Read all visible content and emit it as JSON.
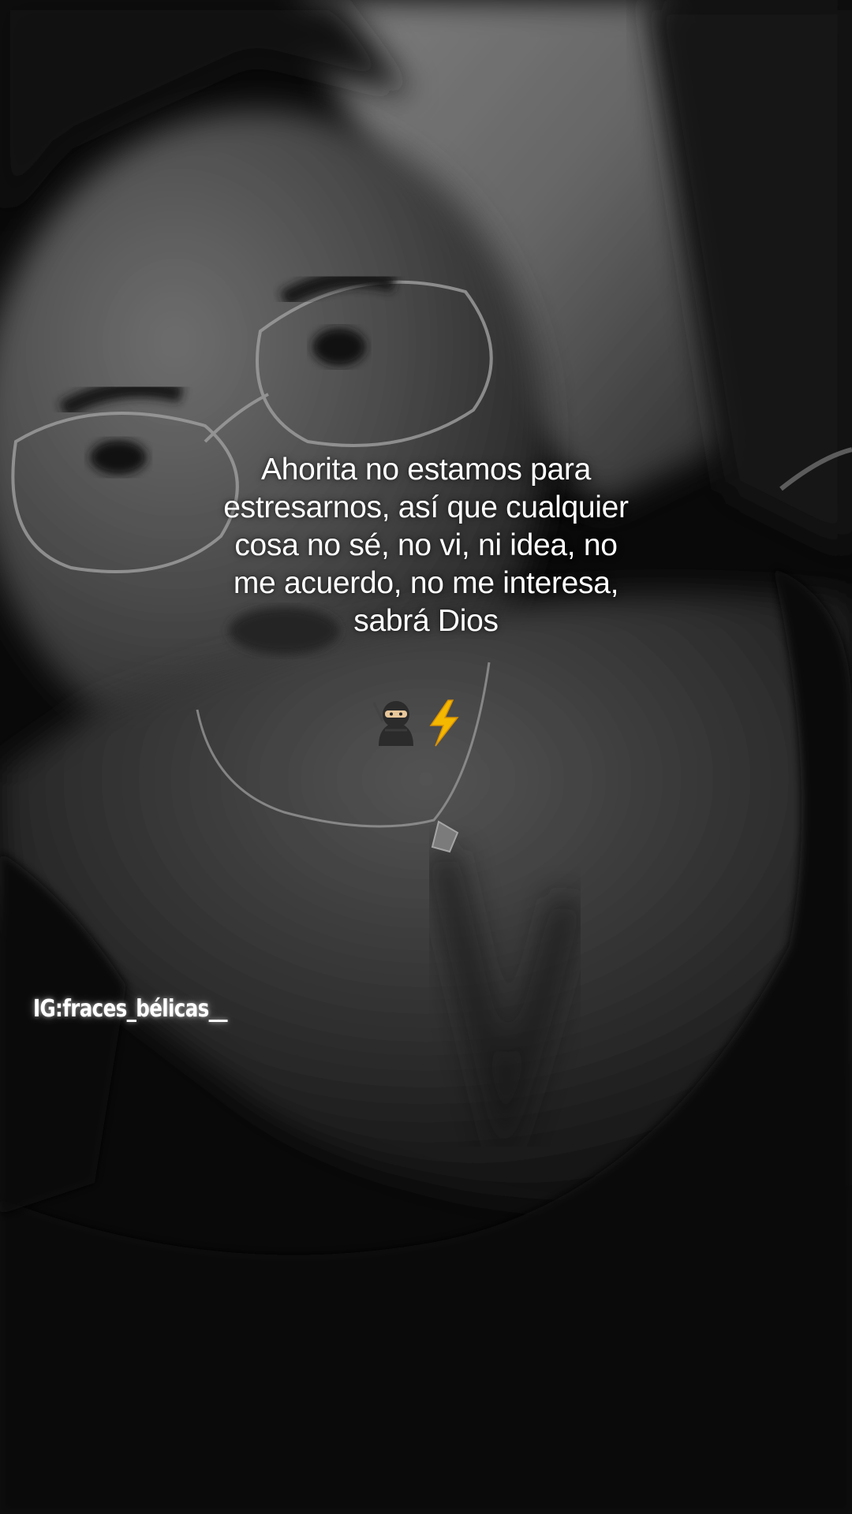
{
  "caption": {
    "line1": "Ahorita no estamos para",
    "line2": "estresarnos, así que cualquier",
    "line3": "cosa no sé, no vi, ni idea, no",
    "line4": "me acuerdo, no me interesa,",
    "line5": "sabrá Dios"
  },
  "emojis": {
    "first_icon": "ninja-icon",
    "second_icon": "lightning-bolt-icon"
  },
  "watermark": {
    "handle": "IG:fraces_bélicas__"
  },
  "colors": {
    "text": "#ffffff",
    "photo_tone": "grayscale",
    "bolt": "#f5b800"
  }
}
